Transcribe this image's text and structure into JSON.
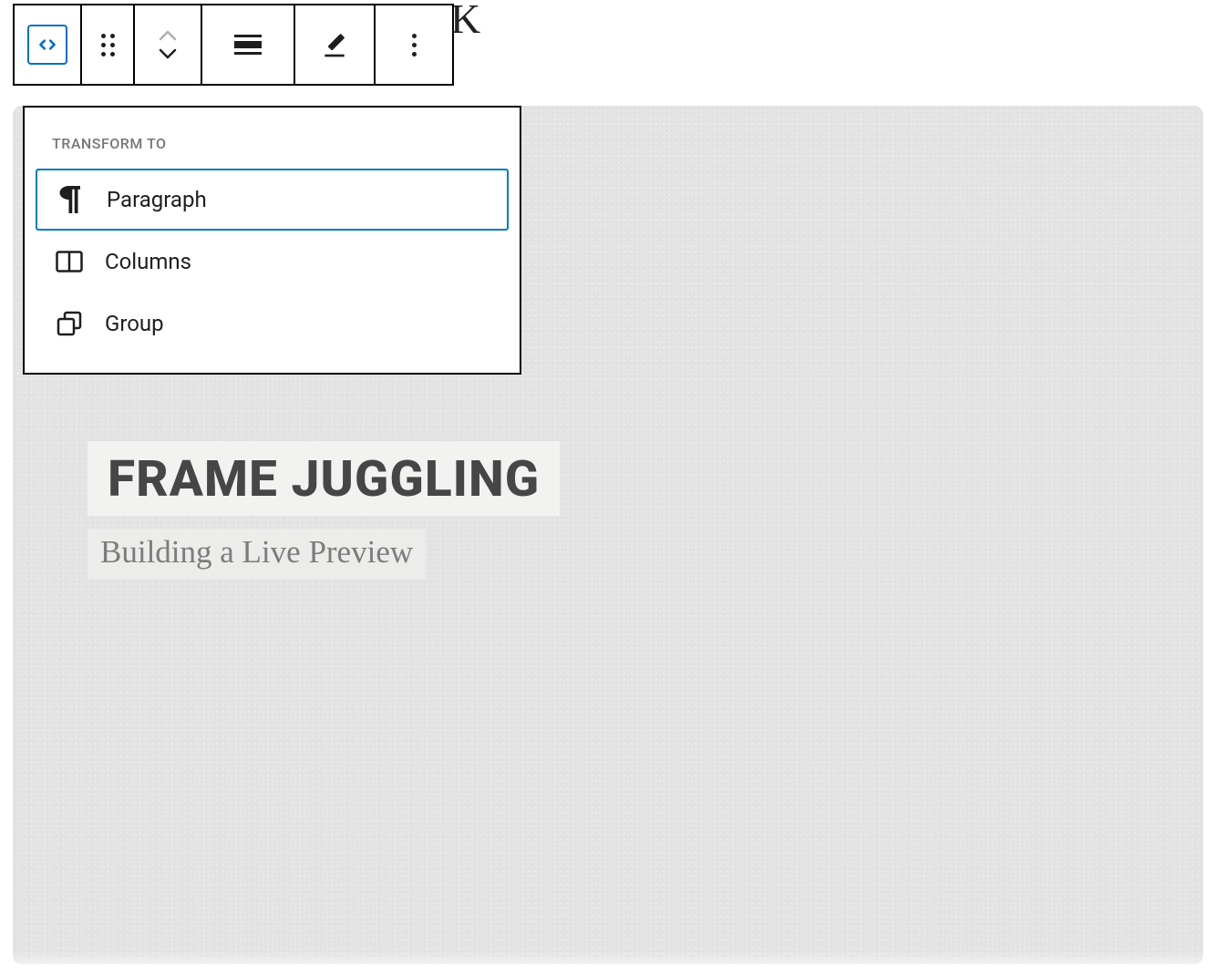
{
  "toolbar": {
    "block_type_icon": "html-icon"
  },
  "popover": {
    "title": "Transform to",
    "items": [
      {
        "icon": "paragraph-icon",
        "label": "Paragraph",
        "selected": true
      },
      {
        "icon": "columns-icon",
        "label": "Columns",
        "selected": false
      },
      {
        "icon": "group-icon",
        "label": "Group",
        "selected": false
      }
    ]
  },
  "slide": {
    "title": "FRAME JUGGLING",
    "subtitle": "Building a Live Preview"
  },
  "stray_text": "K"
}
